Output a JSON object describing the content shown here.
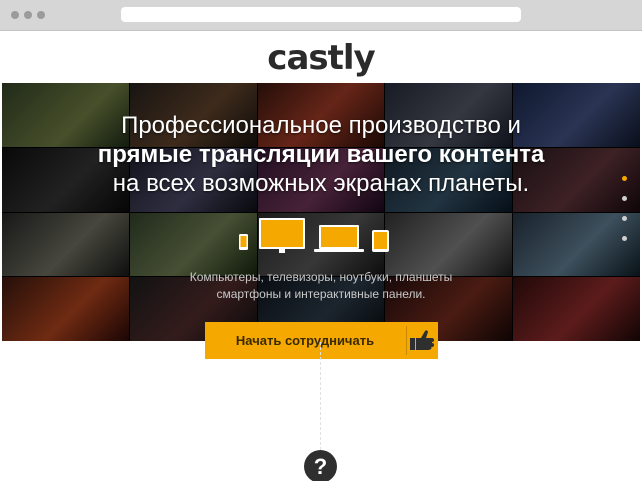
{
  "brand": {
    "name": "castly"
  },
  "hero": {
    "headline_line1": "Профессиональное производство и",
    "headline_line2": "прямые трансляции вашего контента",
    "headline_line3": "на всех возможных экранах планеты.",
    "subtitle_line1": "Компьютеры, телевизоры, ноутбуки, планшеты",
    "subtitle_line2": "смартфоны и интерактивные панели.",
    "slider_dots": [
      true,
      false,
      false,
      false
    ]
  },
  "cta": {
    "label": "Начать сотрудничать",
    "icon": "hand-pointer-icon"
  },
  "help": {
    "label": "?",
    "icon": "question-icon"
  },
  "colors": {
    "accent": "#f5a800",
    "dark": "#2f2f2f",
    "chrome": "#d6d6d6"
  }
}
